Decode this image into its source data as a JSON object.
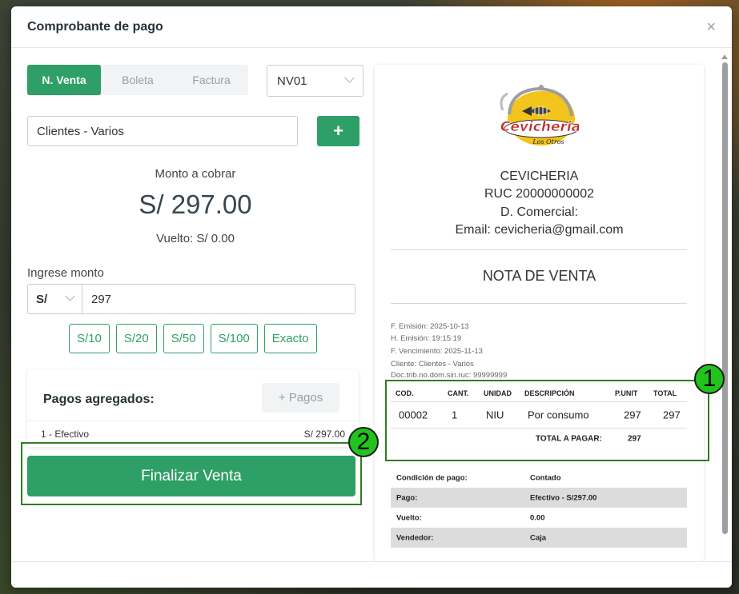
{
  "modal": {
    "title": "Comprobante de pago",
    "close_glyph": "×"
  },
  "doc_tabs": [
    {
      "label": "N. Venta",
      "active": true
    },
    {
      "label": "Boleta",
      "active": false
    },
    {
      "label": "Factura",
      "active": false
    }
  ],
  "series_select": {
    "value": "NV01"
  },
  "client": {
    "value": "Clientes - Varios",
    "add_label": "+"
  },
  "summary": {
    "amount_label": "Monto a cobrar",
    "amount_value": "S/ 297.00",
    "change_label": "Vuelto: S/ 0.00"
  },
  "payment_input": {
    "label": "Ingrese monto",
    "currency": "S/",
    "value": "297"
  },
  "quick_amounts": [
    "S/10",
    "S/20",
    "S/50",
    "S/100",
    "Exacto"
  ],
  "payments": {
    "title": "Pagos agregados:",
    "add_label": "+ Pagos",
    "rows": [
      {
        "label": "1 - Efectivo",
        "amount": "S/ 297.00"
      }
    ]
  },
  "finalize_label": "Finalizar Venta",
  "receipt": {
    "logo_text": "Cevicheria",
    "logo_sub": "Los Otros",
    "business_lines": [
      "CEVICHERIA",
      "RUC 20000000002",
      "D. Comercial:",
      "Email: cevicheria@gmail.com"
    ],
    "doc_title": "NOTA DE VENTA",
    "meta": [
      "F. Emisión: 2025-10-13",
      "H. Emisión: 19:15:19",
      "F. Vencimiento: 2025-11-13",
      "Cliente: Clientes - Varios",
      "Doc.trib.no.dom.sin.ruc: 99999999"
    ],
    "items_headers": [
      "COD.",
      "CANT.",
      "UNIDAD",
      "DESCRIPCIÓN",
      "P.UNIT",
      "TOTAL"
    ],
    "items": [
      {
        "cod": "00002",
        "cant": "1",
        "unidad": "NIU",
        "desc": "Por consumo",
        "punit": "297",
        "total": "297"
      }
    ],
    "total_label": "TOTAL A PAGAR:",
    "total_value": "297",
    "conditions": [
      {
        "label": "Condición de pago:",
        "value": "Contado"
      },
      {
        "label": "Pago:",
        "value": "Efectivo - S/297.00"
      },
      {
        "label": "Vuelto:",
        "value": "0.00"
      },
      {
        "label": "Vendedor:",
        "value": "Caja"
      }
    ]
  },
  "annotations": {
    "badge_1": "1",
    "badge_2": "2"
  },
  "colors": {
    "accent": "#2e9f66",
    "annotation_box": "#2f7d1e",
    "annotation_badge": "#22c31d"
  }
}
